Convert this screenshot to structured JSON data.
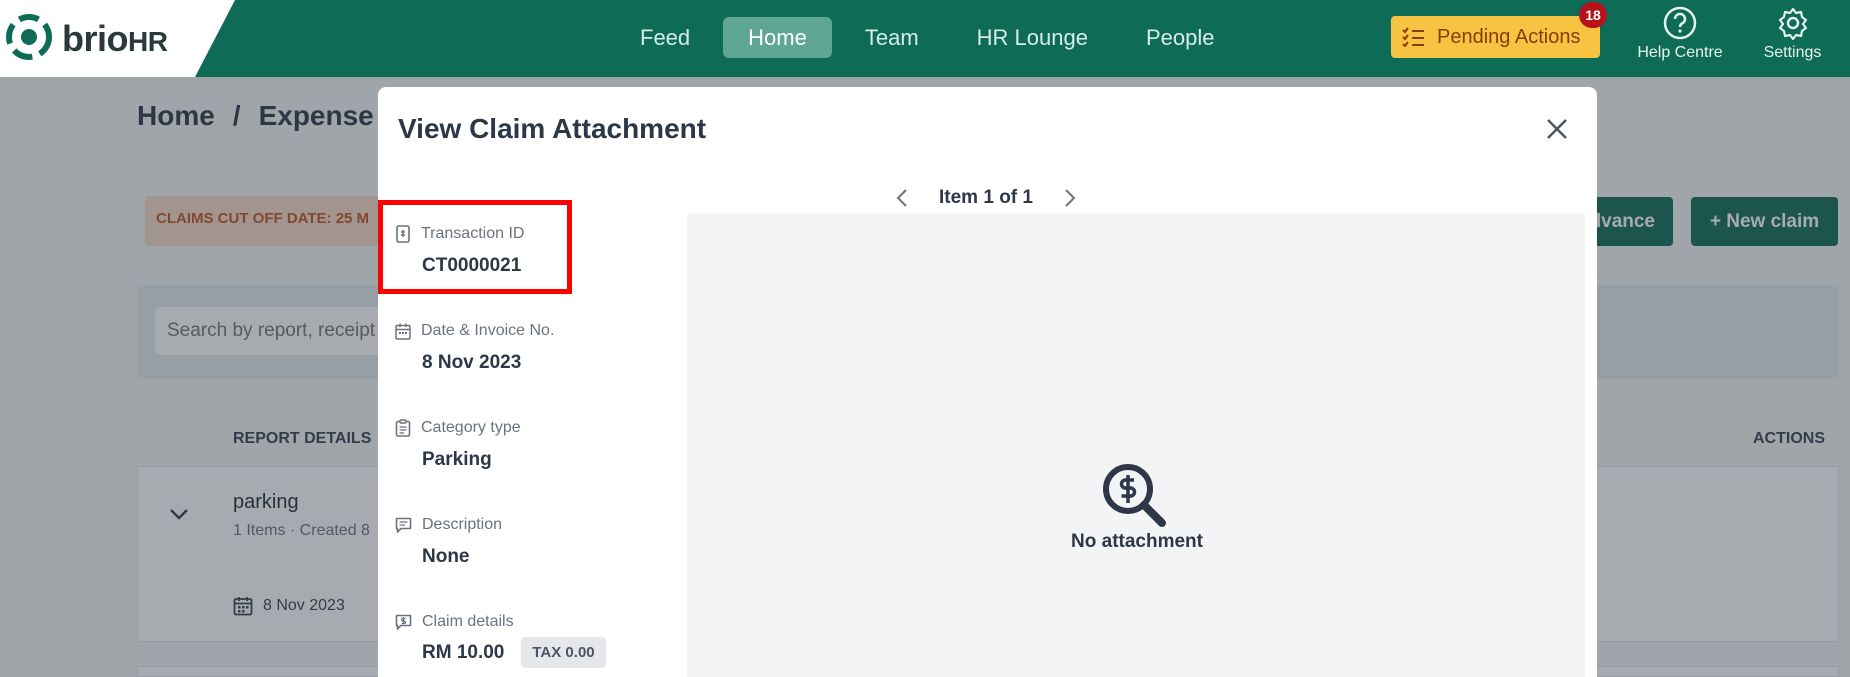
{
  "brand": {
    "name": "brio",
    "suffix": "HR"
  },
  "nav": {
    "items": [
      {
        "label": "Feed",
        "active": false
      },
      {
        "label": "Home",
        "active": true
      },
      {
        "label": "Team",
        "active": false
      },
      {
        "label": "HR Lounge",
        "active": false
      },
      {
        "label": "People",
        "active": false
      }
    ]
  },
  "pending_actions": {
    "label": "Pending Actions",
    "count": "18"
  },
  "help": {
    "label": "Help Centre"
  },
  "settings": {
    "label": "Settings"
  },
  "page": {
    "breadcrumb": [
      "Home",
      "/",
      "Expense"
    ],
    "cutoff_text": "CLAIMS CUT OFF DATE: 25 M",
    "advance_label": "lvance",
    "new_claim_label": "+ New claim",
    "search_placeholder": "Search by report, receipt",
    "columns": {
      "report": "REPORT DETAILS",
      "actions": "ACTIONS"
    },
    "claim": {
      "title": "parking",
      "meta": "1 Items · Created 8",
      "date": "8 Nov 2023"
    }
  },
  "modal": {
    "title": "View Claim Attachment",
    "pager_label": "Item 1 of 1",
    "fields": {
      "transaction": {
        "label": "Transaction ID",
        "value": "CT0000021"
      },
      "date": {
        "label": "Date & Invoice No.",
        "value": "8 Nov 2023"
      },
      "category": {
        "label": "Category type",
        "value": "Parking"
      },
      "description": {
        "label": "Description",
        "value": "None"
      },
      "claim": {
        "label": "Claim details",
        "value": "RM 10.00",
        "tax": "TAX 0.00"
      }
    },
    "empty_state": "No attachment"
  },
  "colors": {
    "brand_green": "#0e6b56",
    "nav_active": "#5fa693",
    "pending_bg": "#f6c343",
    "badge_red": "#b5121b",
    "highlight": "#ff0000"
  }
}
